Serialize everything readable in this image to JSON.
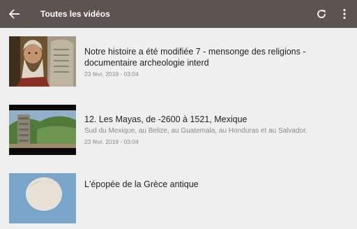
{
  "appbar": {
    "title": "Toutes les vidéos",
    "back_icon": "arrow-left-icon",
    "refresh_icon": "refresh-icon",
    "more_icon": "more-vertical-icon",
    "background": "#5d5452"
  },
  "videos": [
    {
      "title": "Notre histoire a été modifiée 7 - mensonge des religions - documentaire archeologie interd",
      "subtitle": "",
      "date": "23 févr. 2019 - 03:04"
    },
    {
      "title": "12. Les Mayas, de -2600 à 1521, Mexique",
      "subtitle": "Sud du Mexique, au Belize, au Guatemala, au Honduras et au Salvador.",
      "date": "23 févr. 2019 - 03:04"
    },
    {
      "title": "L'épopée de la Grèce antique",
      "subtitle": "",
      "date": ""
    }
  ]
}
